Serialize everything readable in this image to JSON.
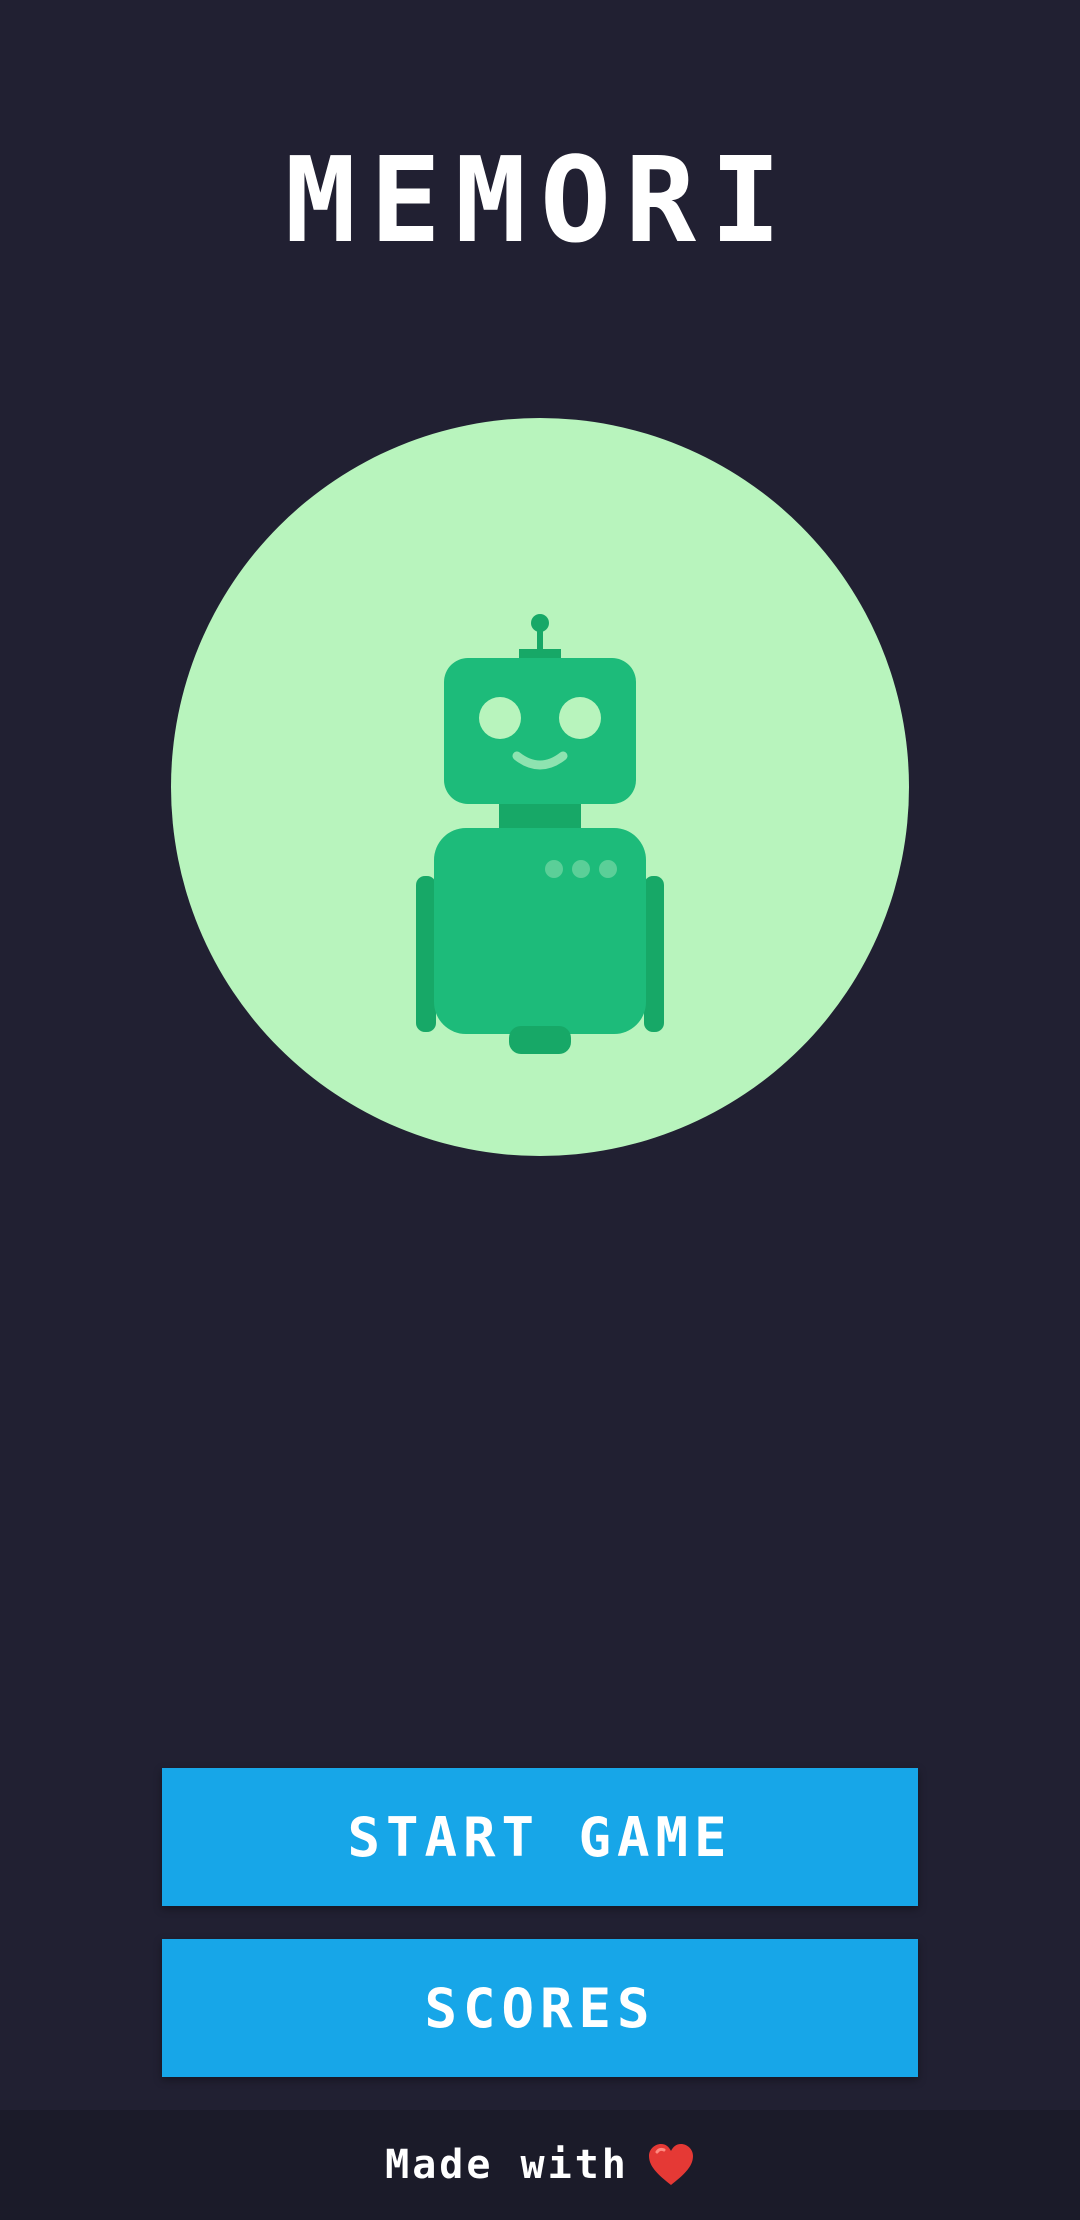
{
  "app": {
    "title": "MEMORI"
  },
  "hero": {
    "illustration": "robot-icon",
    "colors": {
      "circle": "#b8f4bd",
      "robot": "#1dbb7a",
      "robot_dark": "#17a867",
      "accent": "#8ee3b0"
    }
  },
  "menu": {
    "start_label": "START GAME",
    "scores_label": "SCORES",
    "button_color": "#17a6e8"
  },
  "footer": {
    "text": "Made with",
    "icon": "heart-icon",
    "heart_color": "#e53935"
  },
  "theme": {
    "background": "#212032",
    "footer_background": "#1b1b29"
  }
}
